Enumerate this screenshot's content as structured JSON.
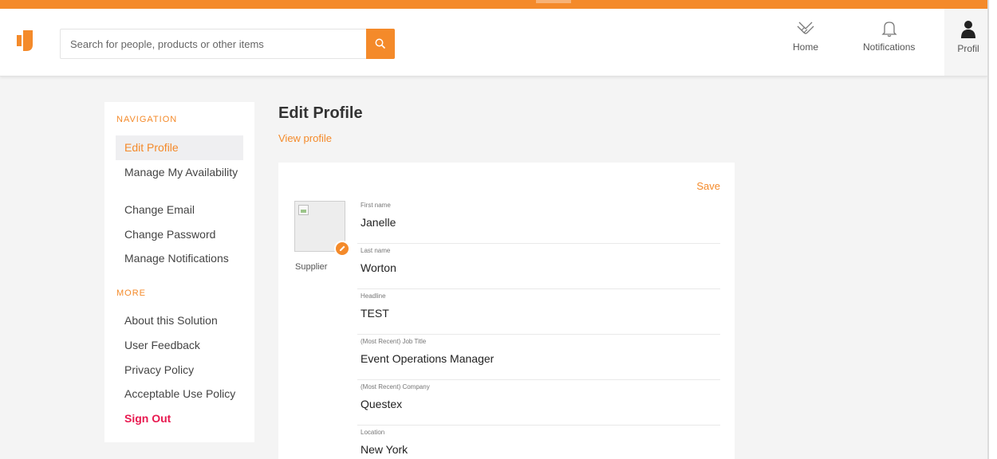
{
  "header": {
    "search_placeholder": "Search for people, products or other items",
    "nav": [
      {
        "label": "Home",
        "icon": "handshake-icon"
      },
      {
        "label": "Notifications",
        "icon": "bell-icon"
      },
      {
        "label": "Profil",
        "icon": "person-icon"
      }
    ]
  },
  "sidebar": {
    "navigation_label": "NAVIGATION",
    "navigation_items": [
      {
        "label": "Edit Profile"
      },
      {
        "label": "Manage My Availability"
      },
      {
        "label": "Change Email"
      },
      {
        "label": "Change Password"
      },
      {
        "label": "Manage Notifications"
      }
    ],
    "more_label": "MORE",
    "more_items": [
      {
        "label": "About this Solution"
      },
      {
        "label": "User Feedback"
      },
      {
        "label": "Privacy Policy"
      },
      {
        "label": "Acceptable Use Policy"
      },
      {
        "label": "Sign Out"
      }
    ]
  },
  "main": {
    "title": "Edit Profile",
    "view_profile": "View profile",
    "save": "Save",
    "role": "Supplier",
    "fields": [
      {
        "label": "First name",
        "value": "Janelle"
      },
      {
        "label": "Last name",
        "value": "Worton"
      },
      {
        "label": "Headline",
        "value": "TEST"
      },
      {
        "label": "(Most Recent) Job Title",
        "value": "Event Operations Manager"
      },
      {
        "label": "(Most Recent) Company",
        "value": "Questex"
      },
      {
        "label": "Location",
        "value": "New York"
      }
    ]
  },
  "colors": {
    "accent": "#f48a2a",
    "signout": "#e8194f",
    "background": "#f4f4f4"
  }
}
